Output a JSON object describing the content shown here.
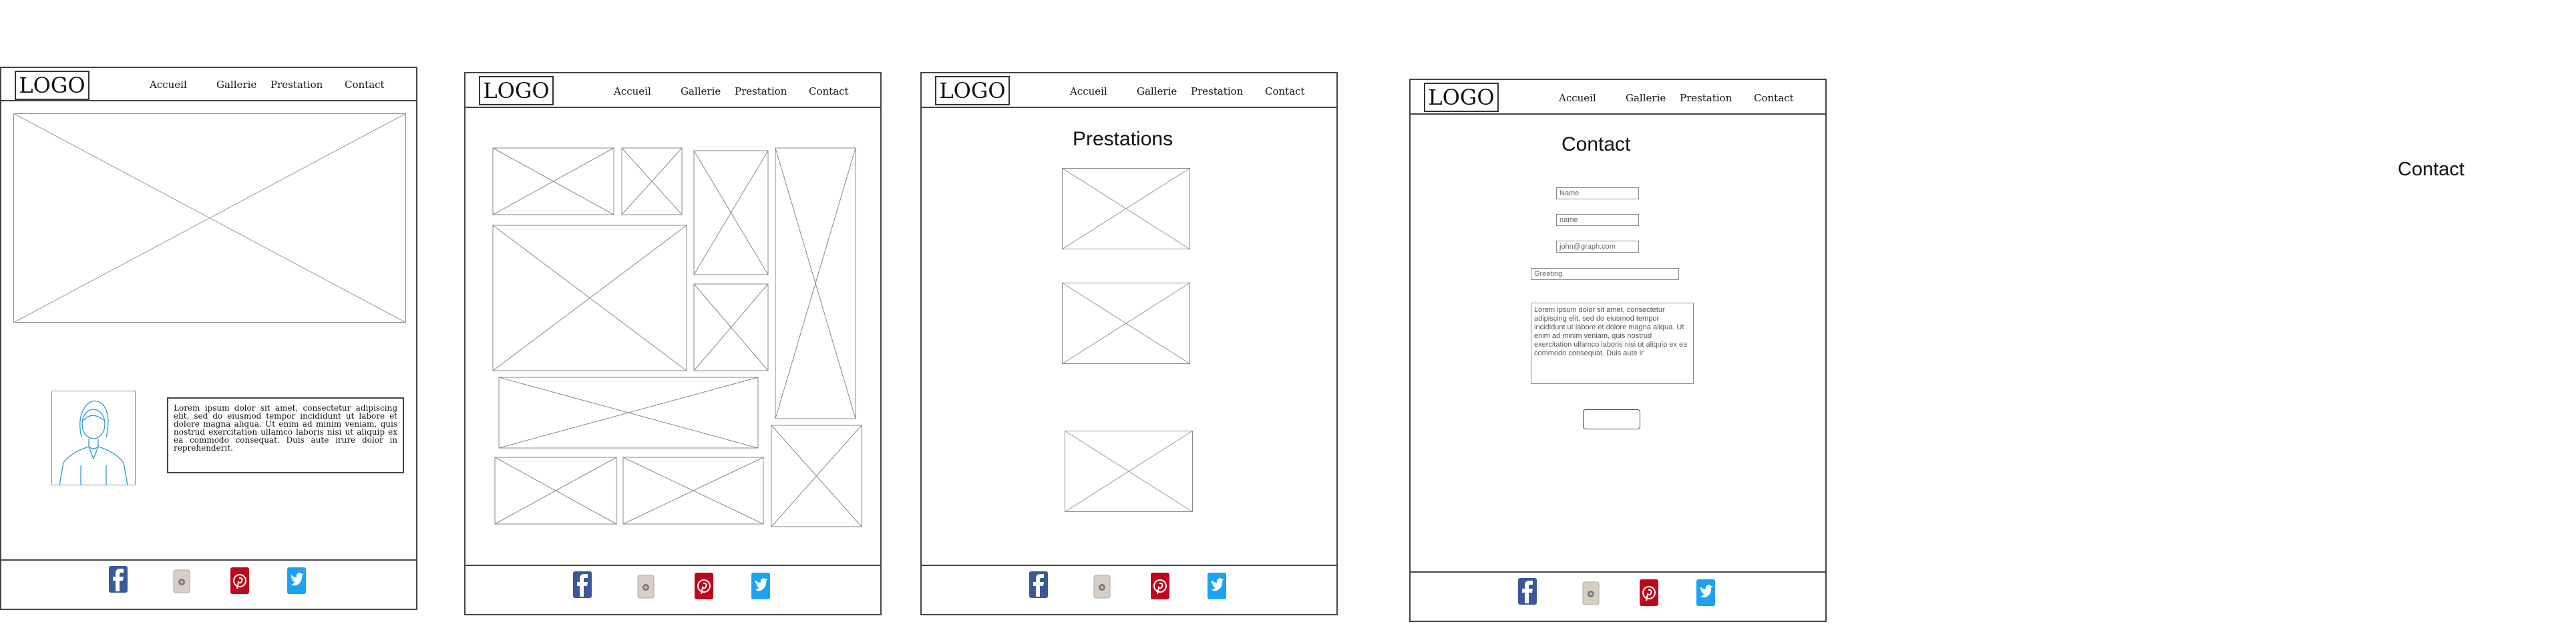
{
  "brand": {
    "logo_text": "LOGO"
  },
  "nav": {
    "home": "Accueil",
    "gallery": "Gallerie",
    "services": "Prestation",
    "contact": "Contact"
  },
  "social": [
    "facebook-icon",
    "instagram-icon",
    "pinterest-icon",
    "twitter-icon"
  ],
  "colors": {
    "facebook": "#3b5998",
    "pinterest": "#bd081c",
    "twitter": "#1da1f2",
    "avatar_line": "#2a9ad8"
  },
  "home_page": {
    "bio_text": "Lorem ipsum dolor sit amet, consectetur adipiscing elit, sed do eiusmod tempor incididunt ut labore et dolore magna aliqua. Ut enim ad minim veniam, quis nostrud exercitation ullamco laboris nisi ut aliquip ex ea commodo consequat. Duis aute irure dolor in reprehenderit."
  },
  "prestations_page": {
    "title": "Prestations"
  },
  "contact_page": {
    "title": "Contact",
    "field1_placeholder": "Name",
    "field2_placeholder": "name",
    "field3_placeholder": "john@graph.com",
    "field4_placeholder": "Greeting",
    "message_text": "Lorem ipsum dolor sit amet, consectetur adipiscing elit, sed do eiusmod tempor incididunt ut labore et dolore magna aliqua. Ut enim ad minim veniam, quis nostrud exercitation ullamco laboris nisi ut aliquip ex ea commodo consequat. Duis aute ir"
  },
  "floating_label": "Contact"
}
